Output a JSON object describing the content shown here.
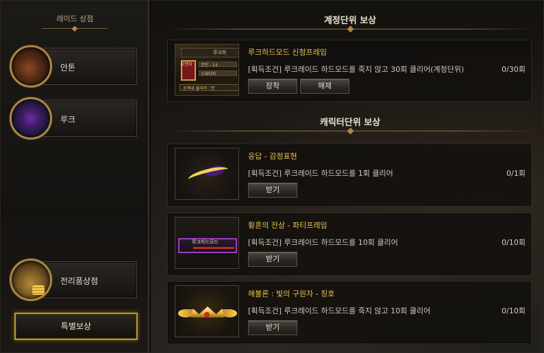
{
  "sidebar": {
    "title": "레이드 상점",
    "raids": [
      {
        "label": "안톤",
        "portrait": "anton-portrait"
      },
      {
        "label": "루크",
        "portrait": "luke-portrait"
      }
    ],
    "shop": {
      "label": "전리품상점",
      "portrait": "treasure-chest-icon"
    },
    "special_button": "특별보상"
  },
  "main": {
    "account_section_title": "계정단위 보상",
    "character_section_title": "캐릭터단위 보상",
    "account_rewards": [
      {
        "name": "루크하드모드 신청프레임",
        "condition": "[획득조건] 루크레이드 하드모드를 죽지 않고 30회 클리어(계정단위)",
        "count": "0/30회",
        "equip_button": "장착",
        "unequip_button": "해제",
        "thumb_text": {
          "head": "루크하",
          "tag": "오연자",
          "line1": "코인 : 14",
          "line2": "스테이지",
          "bottom": "공격대 클리어 : 안"
        }
      }
    ],
    "character_rewards": [
      {
        "name": "응답 - 감정표현",
        "condition": "[획득조건] 루크레이드 하드모드를 1회 클리어",
        "count": "0/1회",
        "button": "받기"
      },
      {
        "name": "황혼의 잔상 - 파티프레임",
        "condition": "[획득조건] 루크레이드 하드모드를 10회 클리어",
        "count": "0/10회",
        "button": "받기",
        "thumb_text": "루크하드모드"
      },
      {
        "name": "해불론 : 빛의 구원자 - 칭호",
        "condition": "[획득조건] 루크레이드 하드모드를 죽지 않고 10회 클리어",
        "count": "0/10회",
        "button": "받기"
      }
    ]
  },
  "colors": {
    "reward_name": "#e8c34d",
    "accent_gold": "#b8972f",
    "party_frame": "#9a3ec2"
  }
}
